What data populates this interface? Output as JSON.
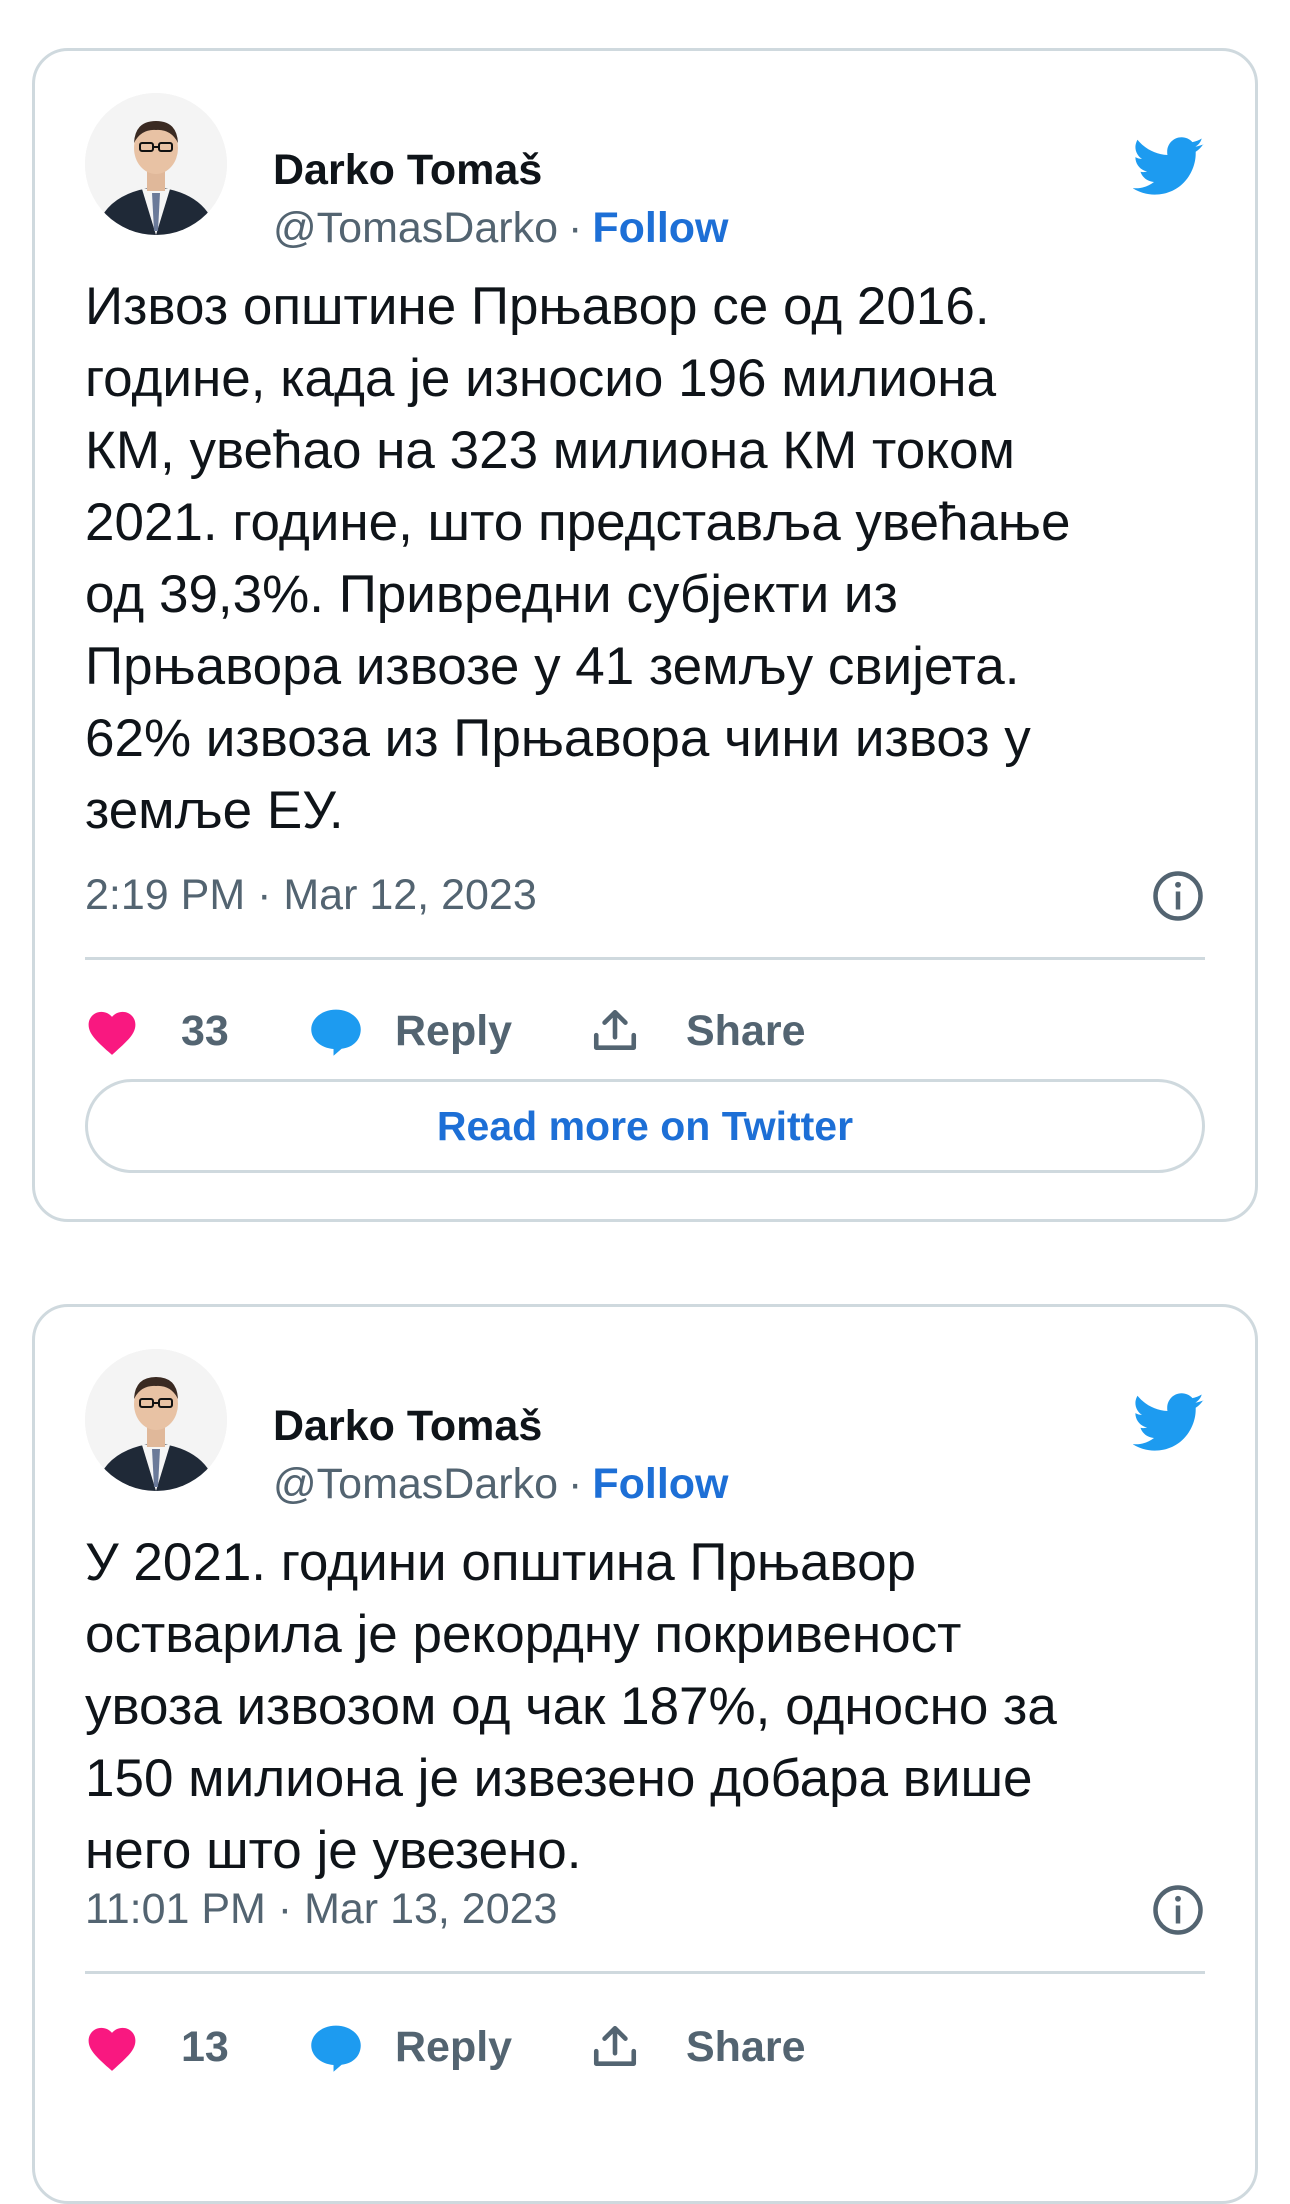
{
  "tweets": [
    {
      "author_name": "Darko Tomaš",
      "handle": "@TomasDarko",
      "separator": "·",
      "follow_label": "Follow",
      "text": "Извоз општине Прњавор се од 2016.\nгодине, када је износио 196 милиона\nКМ, увећао на 323 милиона КМ током\n2021. године, што представља увећање\nод 39,3%. Привредни субјекти из\nПрњавора извозе у  41 земљу свијета.\n62% извоза из Прњавора чини извоз у\nземље ЕУ.",
      "timestamp": "2:19 PM · Mar 12, 2023",
      "likes": "33",
      "reply_label": "Reply",
      "share_label": "Share",
      "read_more_label": "Read more on Twitter"
    },
    {
      "author_name": "Darko Tomaš",
      "handle": "@TomasDarko",
      "separator": "·",
      "follow_label": "Follow",
      "text": "У 2021. години општина Прњавор\nостварила је рекордну покривеност\nувоза извозом од чак 187%, односно за\n150 милиона је извезено добара више\nнего што је увезено.",
      "timestamp": "11:01 PM · Mar 13, 2023",
      "likes": "13",
      "reply_label": "Reply",
      "share_label": "Share"
    }
  ],
  "colors": {
    "link_blue": "#1d6fd6",
    "twitter_blue": "#1d9bf0",
    "heart_pink": "#f91880",
    "border_gray": "#cfd9de",
    "meta_gray": "#536471"
  },
  "icons": {
    "brand": "twitter-bird-icon",
    "info": "info-icon",
    "like": "heart-icon",
    "reply": "speech-bubble-icon",
    "share": "share-upload-icon"
  }
}
